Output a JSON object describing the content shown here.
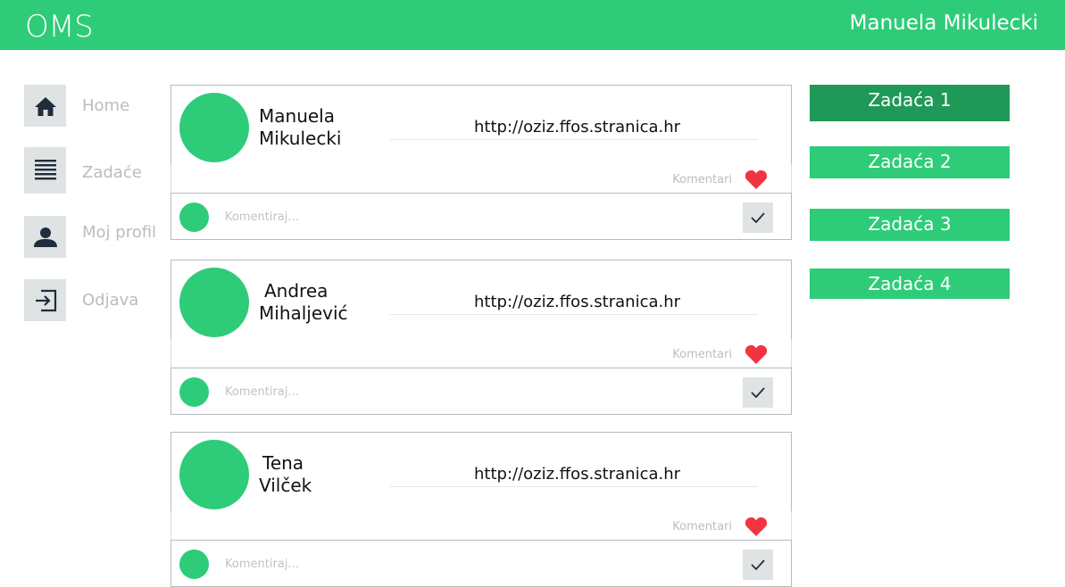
{
  "app": {
    "logo": "OMS",
    "user_name": "Manuela Mikulecki"
  },
  "colors": {
    "brand": "#2ecc78",
    "brand_dark": "#1e9957",
    "heart": "#f23442",
    "icon_bg": "#dfe3e3"
  },
  "sidebar": {
    "items": [
      {
        "label": "Home",
        "icon": "home-icon"
      },
      {
        "label": "Zadaće",
        "icon": "list-icon"
      },
      {
        "label": "Moj profil",
        "icon": "user-icon"
      },
      {
        "label": "Odjava",
        "icon": "logout-icon"
      }
    ]
  },
  "posts": [
    {
      "author_line1": "Manuela",
      "author_line2": "Mikulecki",
      "url": "http://oziz.ffos.stranica.hr",
      "comments_label": "Komentari",
      "comment_placeholder": "Komentiraj..."
    },
    {
      "author_line1": "Andrea",
      "author_line2": "Mihaljević",
      "url": "http://oziz.ffos.stranica.hr",
      "comments_label": "Komentari",
      "comment_placeholder": "Komentiraj..."
    },
    {
      "author_line1": "Tena",
      "author_line2": "Vilček",
      "url": "http://oziz.ffos.stranica.hr",
      "comments_label": "Komentari",
      "comment_placeholder": "Komentiraj..."
    }
  ],
  "tasks": [
    {
      "label": "Zadaća 1",
      "active": true
    },
    {
      "label": "Zadaća 2",
      "active": false
    },
    {
      "label": "Zadaća 3",
      "active": false
    },
    {
      "label": "Zadaća 4",
      "active": false
    }
  ]
}
